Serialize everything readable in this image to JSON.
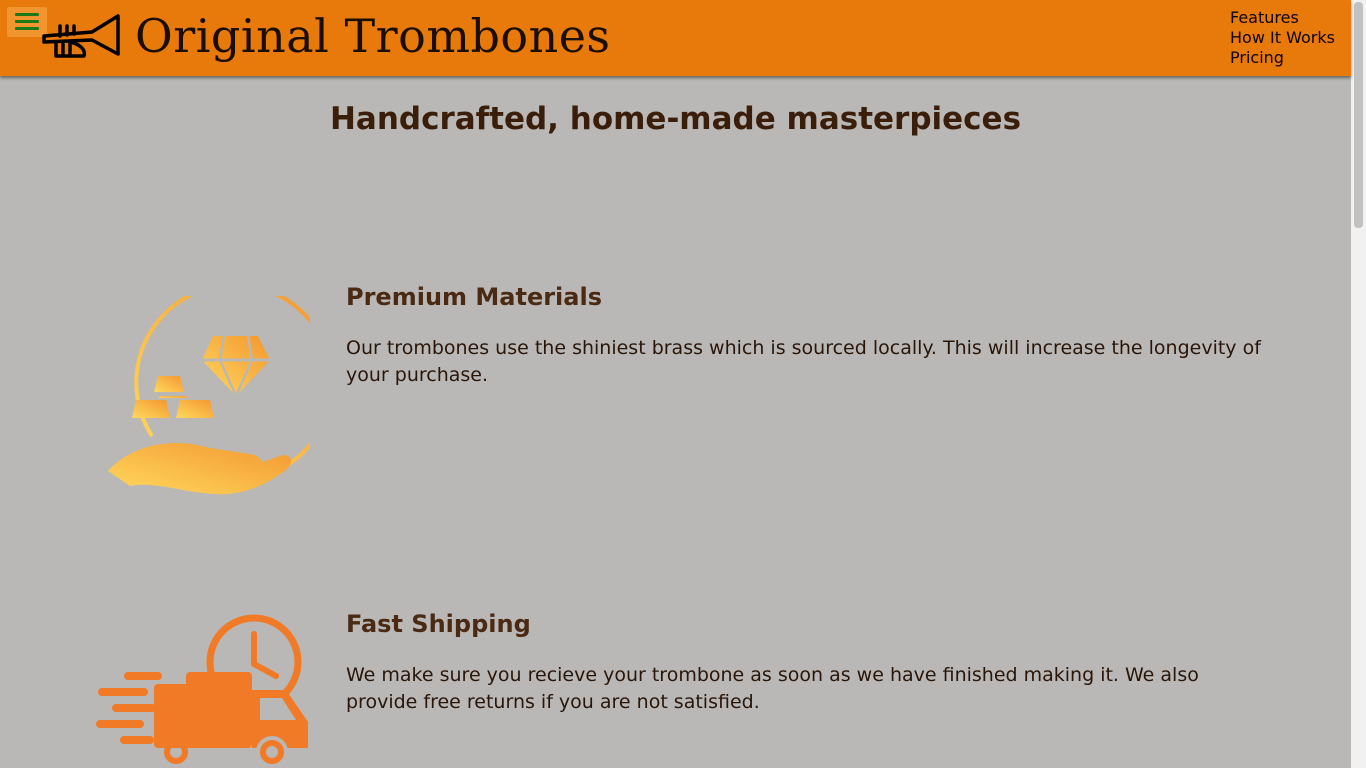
{
  "header": {
    "brand": "Original Trombones",
    "menu_icon": "hamburger-menu-icon",
    "logo_icon": "trumpet-logo-icon",
    "nav": [
      "Features",
      "How It Works",
      "Pricing"
    ]
  },
  "main": {
    "heading": "Handcrafted, home-made masterpieces",
    "features": [
      {
        "icon": "gold-diamond-hand-icon",
        "title": "Premium Materials",
        "text": "Our trombones use the shiniest brass which is sourced locally. This will increase the longevity of your purchase."
      },
      {
        "icon": "delivery-truck-clock-icon",
        "title": "Fast Shipping",
        "text": "We make sure you recieve your trombone as soon as we have finished making it. We also provide free returns if you are not satisfied."
      }
    ]
  },
  "colors": {
    "header_bg": "#e8790b",
    "page_bg": "#b9b8b6",
    "menu_lines": "#1f7a16",
    "accent_orange": "#f07a25",
    "gold_light": "#ffd45e",
    "gold_dark": "#f5a43a"
  }
}
